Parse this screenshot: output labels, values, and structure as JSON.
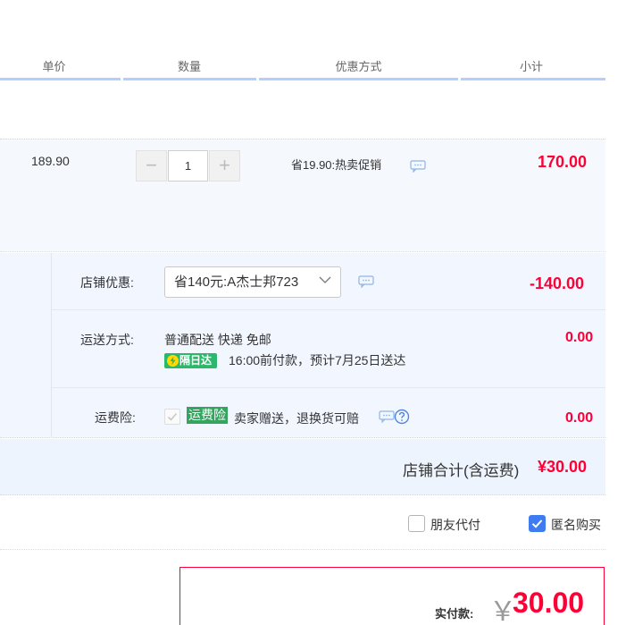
{
  "header": {
    "col_price": "单价",
    "col_qty": "数量",
    "col_discount": "优惠方式",
    "col_subtotal": "小计"
  },
  "item": {
    "price": "189.90",
    "qty_minus": "−",
    "qty_value": "1",
    "qty_plus": "+",
    "discount": "省19.90:热卖促销",
    "subtotal": "170.00"
  },
  "shop": {
    "coupon_label": "店铺优惠:",
    "coupon_selected": "省140元:A杰士邦723",
    "coupon_amount": "-140.00",
    "shipping_label": "运送方式:",
    "shipping_method": "普通配送 快递 免邮",
    "next_day_badge": "隔日达",
    "delivery_note": "16:00前付款，预计7月25日送达",
    "shipping_amount": "0.00",
    "insurance_label": "运费险:",
    "insurance_tag": "运费险",
    "insurance_desc": "卖家赠送，退换货可赔",
    "insurance_amount": "0.00",
    "total_label": "店铺合计(含运费)",
    "total_value": "¥30.00"
  },
  "options": {
    "friend_pay": "朋友代付",
    "anonymous": "匿名购买",
    "friend_pay_checked": false,
    "anonymous_checked": true
  },
  "payment": {
    "label": "实付款:",
    "currency": "￥",
    "amount": "30.00"
  },
  "colors": {
    "accent_red": "#ff0036",
    "header_line": "#b6ceff",
    "badge_green": "#2cb86a",
    "checkbox_blue": "#3f7cf2"
  },
  "icons": {
    "comment": "comment-icon",
    "help": "question-icon",
    "chevron": "chevron-down-icon",
    "bolt": "lightning-icon"
  }
}
